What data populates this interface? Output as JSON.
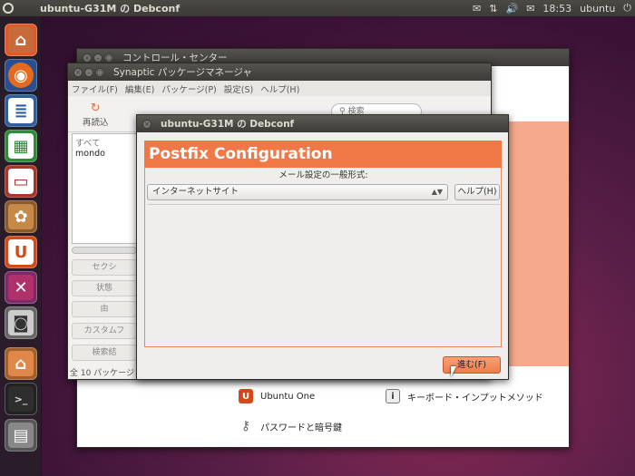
{
  "top_panel": {
    "title": "ubuntu-G31M の Debconf",
    "indicators": [
      "✉",
      "⇅",
      "🔊",
      "✉",
      "18:53",
      "ubuntu",
      "⏻"
    ]
  },
  "launcher": {
    "items": [
      "home-folder",
      "firefox",
      "writer",
      "calc",
      "impress",
      "ubuntu-software",
      "ubuntu-one",
      "settings",
      "screenshot",
      "system",
      "terminal",
      "workspaces"
    ]
  },
  "control_center": {
    "title": "コントロール・センター",
    "ubuntu_one": "Ubuntu One",
    "keyboard_input": "キーボード・インプットメソッド",
    "passwords": "パスワードと暗号鍵"
  },
  "synaptic": {
    "title": "Synaptic パッケージマネージャ",
    "menu": [
      "ファイル(F)",
      "編集(E)",
      "パッケージ(P)",
      "設定(S)",
      "ヘルプ(H)"
    ],
    "reload": "再読込",
    "search_placeholder": "検索",
    "list": [
      "すべて",
      "mondo"
    ],
    "side_buttons": [
      "セクシ",
      "状態",
      "由",
      "カスタムフ",
      "検索結"
    ],
    "status": "全 10 パッケージ"
  },
  "debconf": {
    "title": "ubuntu-G31M の Debconf",
    "header": "Postfix Configuration",
    "prompt": "メール設定の一般形式:",
    "selected": "インターネットサイト",
    "help": "ヘルプ(H)",
    "next": "進む(F)"
  },
  "colors": {
    "accent": "#f07746",
    "panel": "#3c3b37"
  }
}
